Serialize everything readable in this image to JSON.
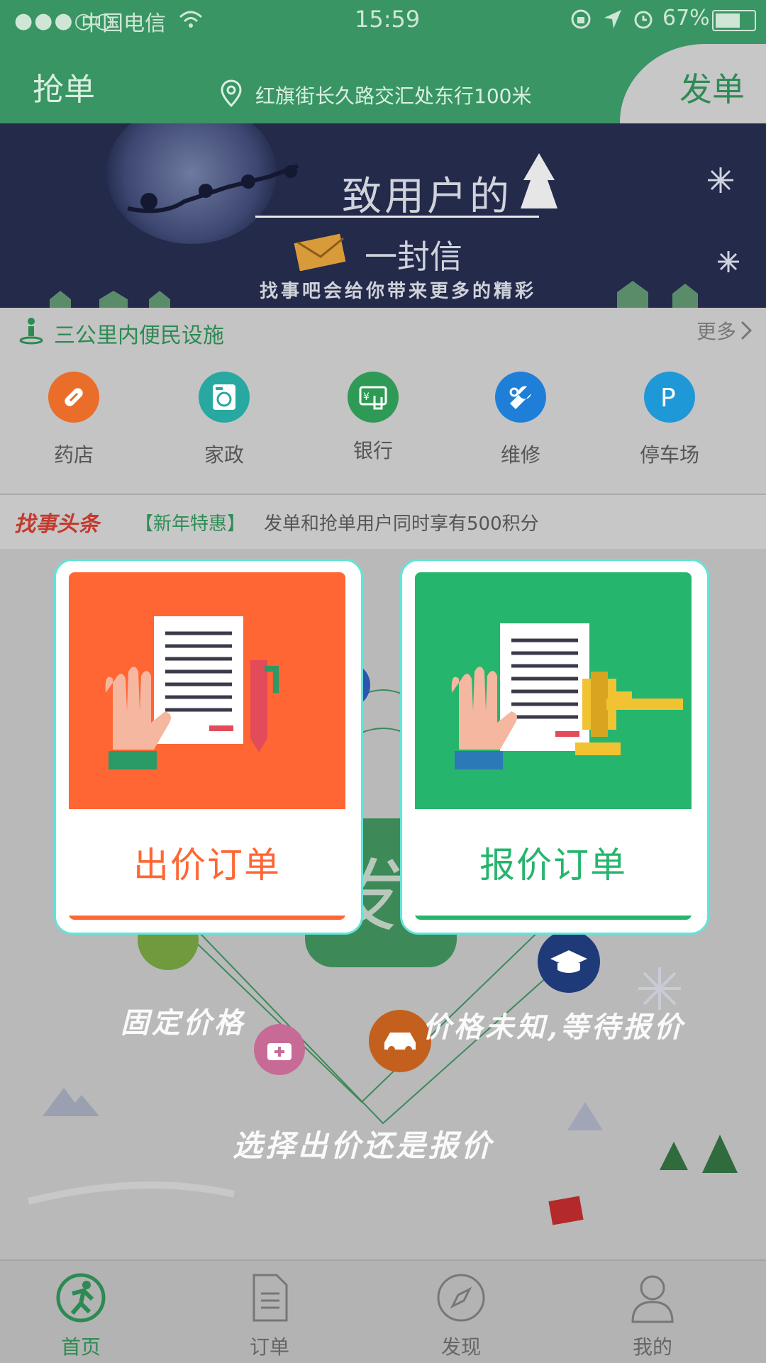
{
  "status_bar": {
    "signal": "●●●○○",
    "carrier": "中国电信",
    "time": "15:59",
    "battery": "67%"
  },
  "navbar": {
    "title": "抢单",
    "location": "红旗街长久路交汇处东行100米",
    "post_button": "发单"
  },
  "banner": {
    "title_line1": "致用户的",
    "title_line2": "一封信",
    "subtitle": "找事吧会给你带来更多的精彩"
  },
  "facilities": {
    "header": "三公里内便民设施",
    "more": "更多",
    "items": [
      {
        "label": "药店",
        "icon": "pill-icon",
        "color": "#ea6d2a"
      },
      {
        "label": "家政",
        "icon": "washing-machine-icon",
        "color": "#27a8a0"
      },
      {
        "label": "银行",
        "icon": "bank-card-icon",
        "color": "#2f9a55"
      },
      {
        "label": "维修",
        "icon": "wrench-icon",
        "color": "#1f7fd8"
      },
      {
        "label": "停车场",
        "icon": "parking-icon",
        "color": "#1f98d8"
      }
    ]
  },
  "news": {
    "logo": "找事头条",
    "tag": "【新年特惠】",
    "text": "发单和抢单用户同时享有500积分"
  },
  "background_overlay": {
    "center_button": "发",
    "fixed_price": "固定价格",
    "unknown_price": "价格未知,等待报价",
    "choose": "选择出价还是报价"
  },
  "cards": {
    "bid_order": {
      "label": "出价订单",
      "color": "#ff6633"
    },
    "quote_order": {
      "label": "报价订单",
      "color": "#26b56c"
    }
  },
  "tabbar": {
    "items": [
      {
        "label": "首页",
        "icon": "runner-icon",
        "active": true
      },
      {
        "label": "订单",
        "icon": "document-icon",
        "active": false
      },
      {
        "label": "发现",
        "icon": "compass-icon",
        "active": false
      },
      {
        "label": "我的",
        "icon": "user-icon",
        "active": false
      }
    ]
  }
}
